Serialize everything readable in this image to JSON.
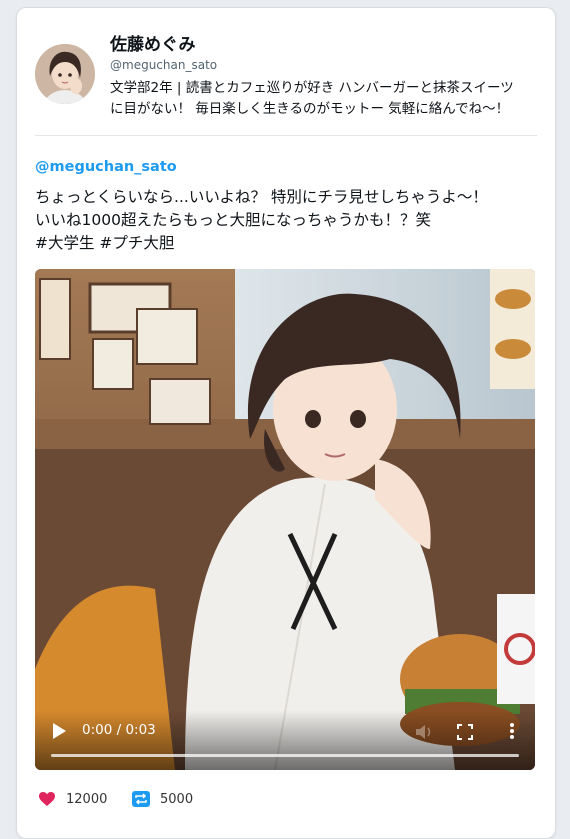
{
  "profile": {
    "name": "佐藤めぐみ",
    "handle": "@meguchan_sato",
    "bio_line1": "文学部2年 | 読書とカフェ巡りが好き ハンバーガーと抹茶スイーツ",
    "bio_line2": "に目がない！ 毎日楽しく生きるのがモットー 気軽に絡んでね～！"
  },
  "post": {
    "mention": "@meguchan_sato",
    "line1": "ちょっとくらいなら...いいよね？ 特別にチラ見せしちゃうよ～！",
    "line2": "いいね1000超えたらもっと大胆になっちゃうかも！？笑",
    "line3": "#大学生 #プチ大胆"
  },
  "video": {
    "time": "0:00 / 0:03",
    "progress": 0
  },
  "stats": {
    "likes": "12000",
    "reposts": "5000"
  },
  "colors": {
    "accent": "#1d9bf0",
    "like": "#e0245e",
    "repost": "#1d9bf0"
  }
}
